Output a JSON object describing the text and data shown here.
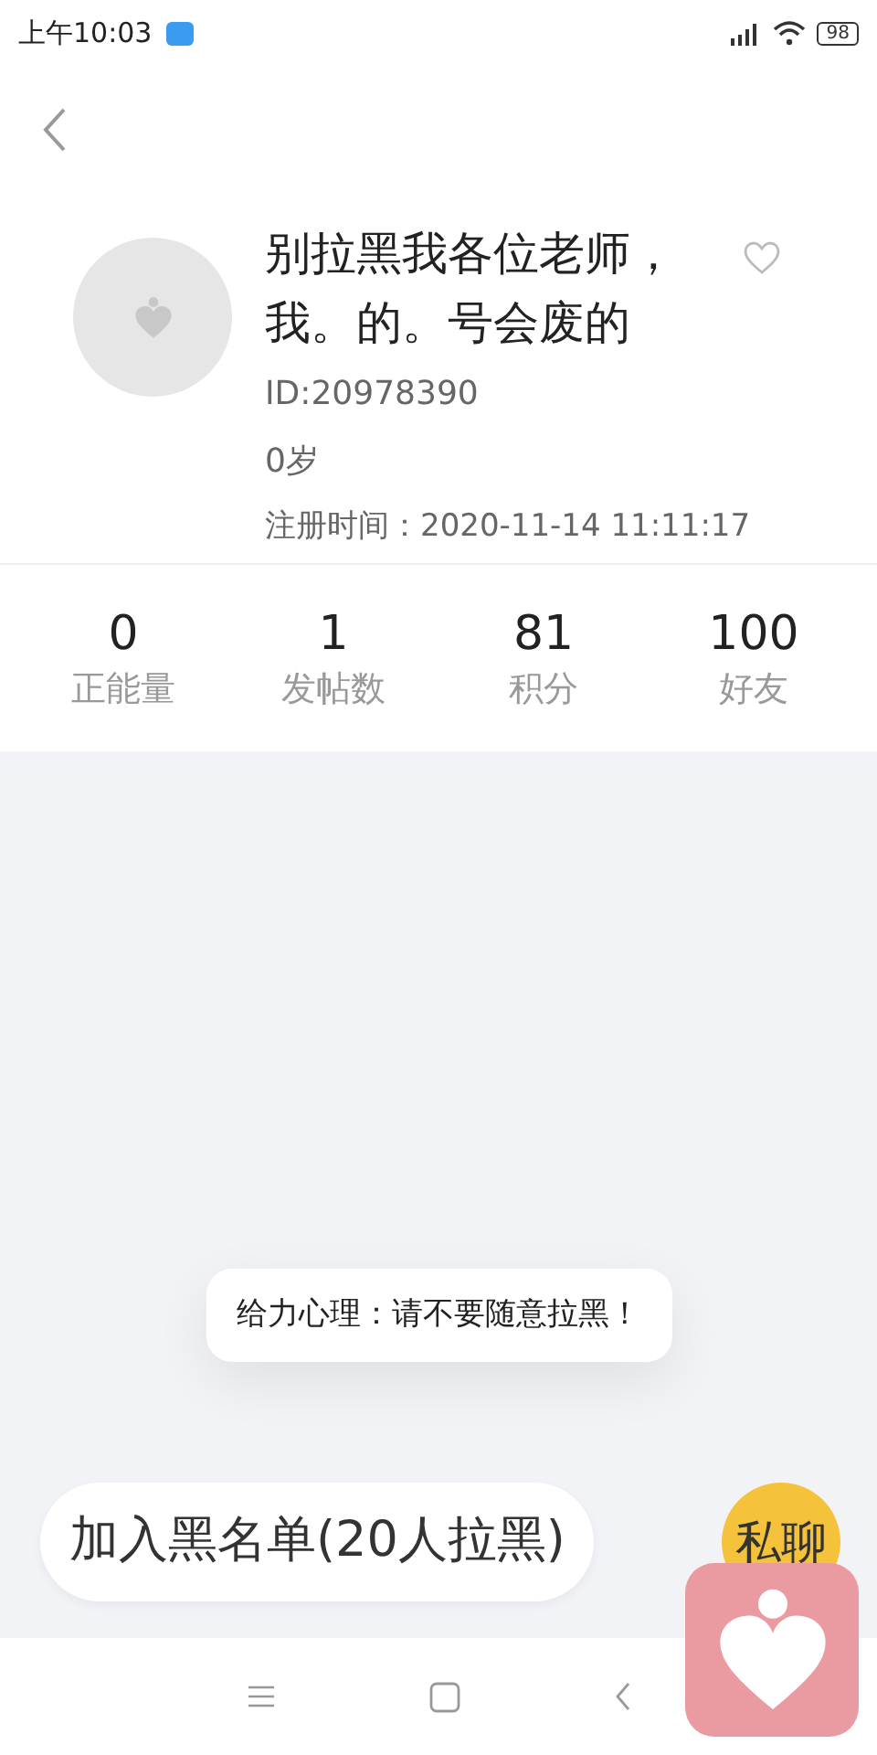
{
  "status_bar": {
    "time": "上午10:03",
    "battery": "98"
  },
  "profile": {
    "name": "别拉黑我各位老师，我。的。号会废的",
    "id": "ID:20978390",
    "age": "0岁",
    "registered": "注册时间：2020-11-14 11:11:17"
  },
  "stats": [
    {
      "value": "0",
      "label": "正能量"
    },
    {
      "value": "1",
      "label": "发帖数"
    },
    {
      "value": "81",
      "label": "积分"
    },
    {
      "value": "100",
      "label": "好友"
    }
  ],
  "toast": "给力心理：请不要随意拉黑！",
  "actions": {
    "block": "加入黑名单(20人拉黑)",
    "chat": "私聊"
  }
}
